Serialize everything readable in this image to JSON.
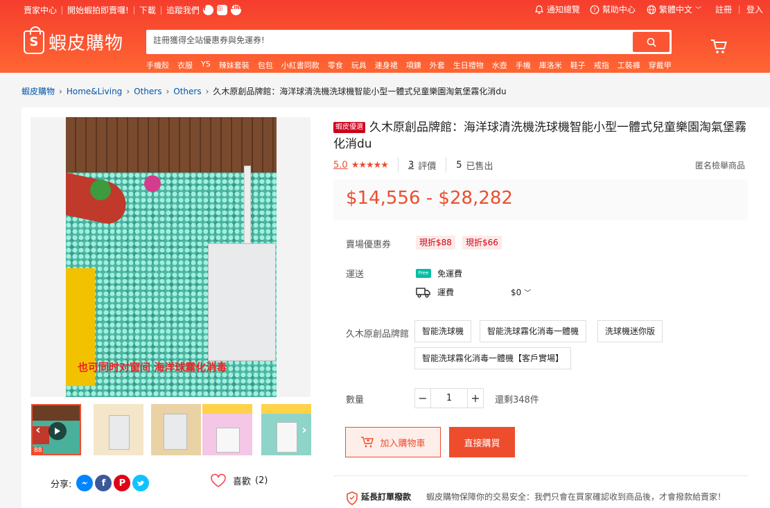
{
  "topbar": {
    "seller_center": "賣家中心",
    "start_selling": "開始蝦拍即賣囉!",
    "download": "下載",
    "follow_us": "追蹤我們",
    "notifications": "通知總覽",
    "help": "幫助中心",
    "language": "繁體中文",
    "register": "註冊",
    "login": "登入"
  },
  "brand": {
    "logo_letter": "S",
    "name": "蝦皮購物"
  },
  "search": {
    "placeholder": "註冊獲得全站優惠券與免運券!"
  },
  "hotwords": [
    "手機殼",
    "衣服",
    "YS",
    "辣妹套裝",
    "包包",
    "小紅書同款",
    "零食",
    "玩具",
    "連身裙",
    "項鍊",
    "外套",
    "生日禮物",
    "水壺",
    "手機",
    "庫洛米",
    "鞋子",
    "戒指",
    "工裝褲",
    "穿戴甲"
  ],
  "breadcrumb": [
    "蝦皮購物",
    "Home&Living",
    "Others",
    "Others"
  ],
  "breadcrumb_current": "久木原創品牌館：海洋球清洗機洗球機智能小型一體式兒童樂園淘氣堡霧化消du",
  "gallery": {
    "caption": "也可同时对窗间  海洋球霧化消毒",
    "thumb_badge": "88"
  },
  "share": {
    "label": "分享:"
  },
  "like": {
    "label": "喜歡",
    "count": "(2)"
  },
  "product": {
    "badge": "蝦皮優選",
    "title": "久木原創品牌館：海洋球清洗機洗球機智能小型一體式兒童樂園淘氣堡霧化消du",
    "rating": "5.0",
    "stars": "★★★★★",
    "review_count": "3",
    "review_label": "評價",
    "sold_count": "5",
    "sold_label": "已售出",
    "report": "匿名檢舉商品",
    "price": "$14,556 - $28,282"
  },
  "vouchers": {
    "label": "賣場優惠券",
    "items": [
      "現折$88",
      "現折$66"
    ]
  },
  "shipping": {
    "label": "運送",
    "free_tag": "Free",
    "free_label": "免運費",
    "fee_label": "運費",
    "fee_value": "$0"
  },
  "variations": {
    "label": "久木原創品牌館",
    "options": [
      "智能洗球機",
      "智能洗球霧化消毒一體機",
      "洗球機迷你版",
      "智能洗球霧化消毒一體機【客戶實場】"
    ]
  },
  "quantity": {
    "label": "數量",
    "value": "1",
    "minus": "−",
    "plus": "+",
    "stock": "還剩348件"
  },
  "actions": {
    "add_to_cart": "加入購物車",
    "buy_now": "直接購買"
  },
  "guarantee": {
    "title": "延長訂單撥款",
    "text": "蝦皮購物保障你的交易安全：我們只會在買家確認收到商品後，才會撥款給賣家！"
  },
  "colors": {
    "brand": "#ee4d2d",
    "header": "#f53d2d",
    "link": "#0055aa"
  }
}
